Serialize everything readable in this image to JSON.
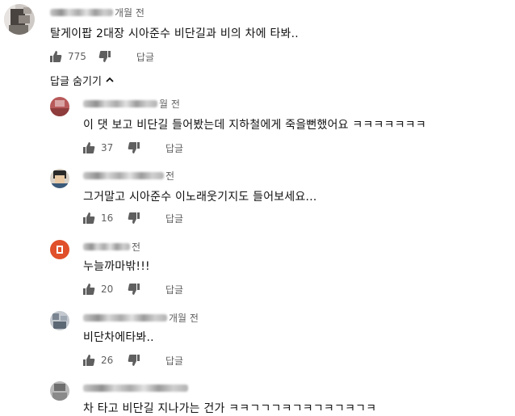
{
  "reply_label": "답글",
  "colors": {
    "text": "#111111",
    "secondary": "#606060",
    "icon": "#5f5f5f"
  },
  "icons": {
    "like": "thumbs-up-icon",
    "dislike": "thumbs-down-icon",
    "collapse": "chevron-up-icon"
  },
  "top_comment": {
    "time": "개월 전",
    "text": "탈게이팝 2대장 시아준수 비단길과 비의 차에 타봐..",
    "likes": "775"
  },
  "replies_toggle": {
    "label": "답글 숨기기"
  },
  "replies": [
    {
      "time": "월 전",
      "text": "이 댓 보고 비단길 들어봤는데 지하철에게 죽을뻔했어요 ㅋㅋㅋㅋㅋㅋㅋ",
      "likes": "37"
    },
    {
      "time": "전",
      "text": "그거말고 시아준수 이노래웃기지도 들어보세요...",
      "likes": "16"
    },
    {
      "time": "전",
      "text": "누늘까마밖!!!",
      "likes": "20"
    },
    {
      "time": "개월 전",
      "text": "비단차에타봐..",
      "likes": "26"
    },
    {
      "time": "",
      "text": "차 타고 비단길 지나가는 건가 ㅋㅋㄱㄱㄱㅋㄱㅋㄱㅋㄱㅋㄱㅋ",
      "likes": ""
    }
  ]
}
